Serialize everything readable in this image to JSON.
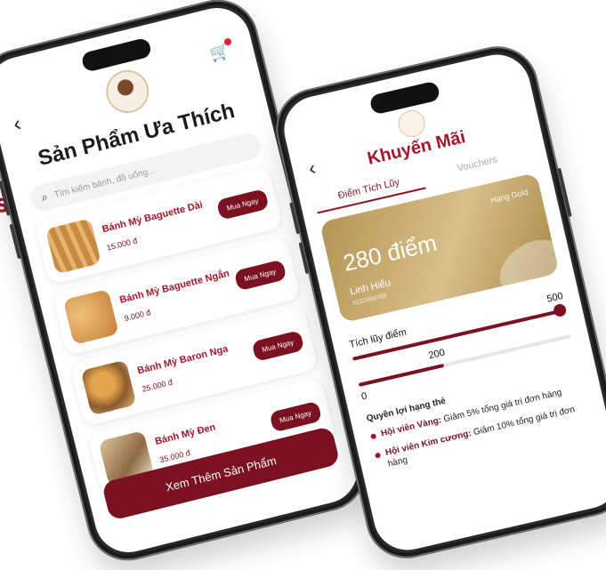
{
  "edge_letter": "s",
  "favorites": {
    "title": "Sản Phẩm Ưa Thích",
    "back_icon": "‹",
    "cart_icon": "🛒",
    "search_placeholder": "Tìm kiếm bánh, đồ uống...",
    "products": [
      {
        "name": "Bánh Mỳ Baguette Dài",
        "price": "15.000 đ",
        "button": "Mua Ngay"
      },
      {
        "name": "Bánh Mỳ Baguette Ngắn",
        "price": "9.000 đ",
        "button": "Mua Ngay"
      },
      {
        "name": "Bánh Mỳ Baron Nga",
        "price": "25.000 đ",
        "button": "Mua Ngay"
      },
      {
        "name": "Bánh Mỳ Đen",
        "price": "35.000 đ",
        "button": "Mua Ngay"
      }
    ],
    "more_button": "Xem Thêm Sản Phẩm"
  },
  "promotions": {
    "title": "Khuyến Mãi",
    "back_icon": "‹",
    "tabs": [
      "Điểm Tích Lũy",
      "Vouchers"
    ],
    "card": {
      "tier": "Hạng Gold",
      "points": "280 điểm",
      "name": "Linh Hiếu",
      "phone": "0123456789"
    },
    "accumulate_label": "Tích lũy điểm",
    "max_label": "500",
    "mid_label": "200",
    "min_label": "0",
    "benefits_title": "Quyền lợi hạng thẻ",
    "benefits": [
      {
        "tier": "Hội viên Vàng:",
        "text": " Giảm 5% tổng giá trị đơn hàng"
      },
      {
        "tier": "Hội viên Kim cương:",
        "text": " Giảm 10% tổng giá trị đơn hàng"
      }
    ]
  }
}
